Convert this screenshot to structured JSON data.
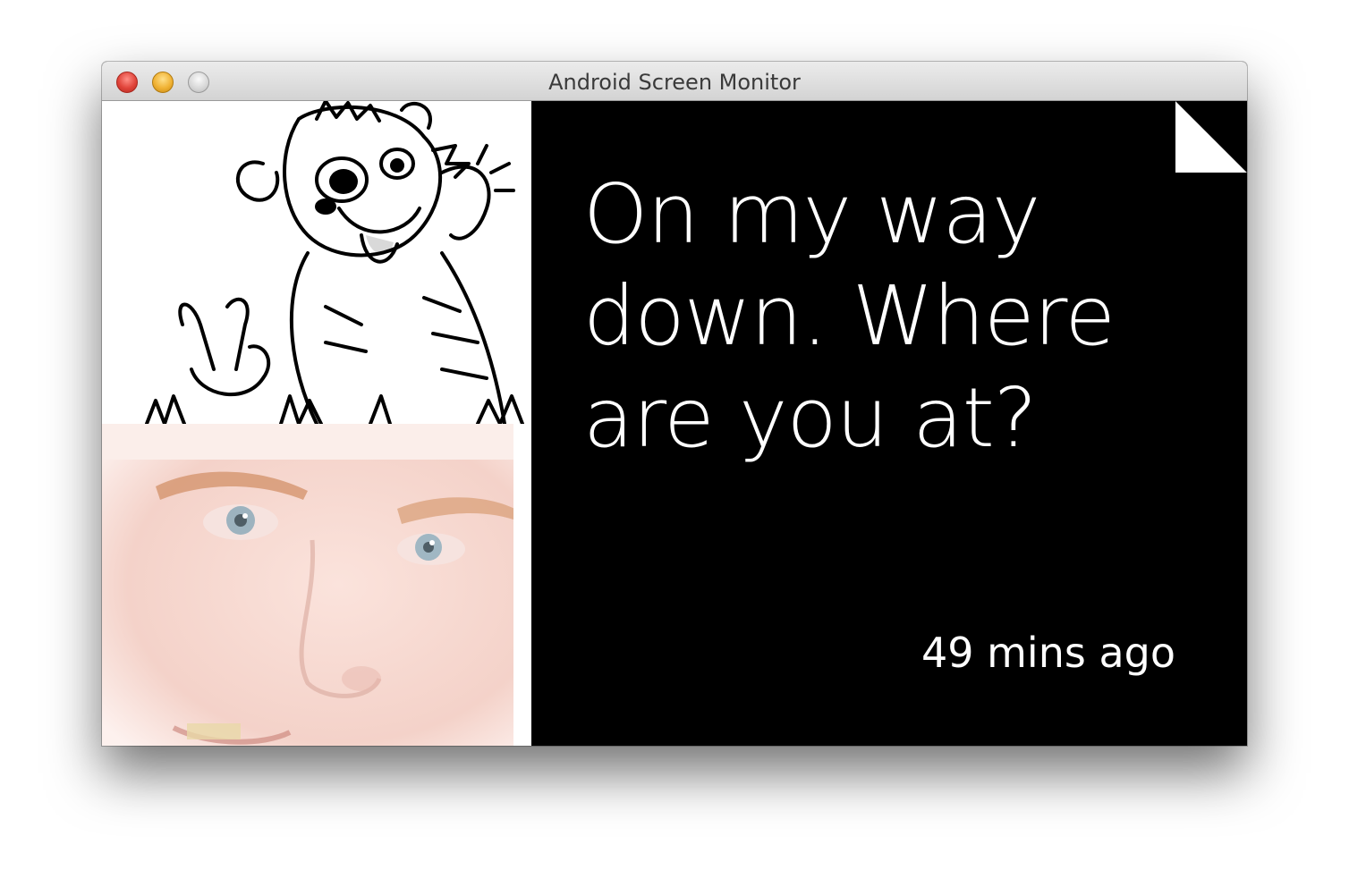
{
  "window": {
    "title": "Android Screen Monitor"
  },
  "card": {
    "message": "On my way\ndown.  Where\nare you at?",
    "timestamp": "49 mins ago",
    "colors": {
      "background": "#000000",
      "text": "#ffffff"
    }
  },
  "icons": {
    "close": "close-traffic-light",
    "minimize": "minimize-traffic-light",
    "zoom": "zoom-traffic-light",
    "page_curl": "bundle-corner-icon"
  }
}
